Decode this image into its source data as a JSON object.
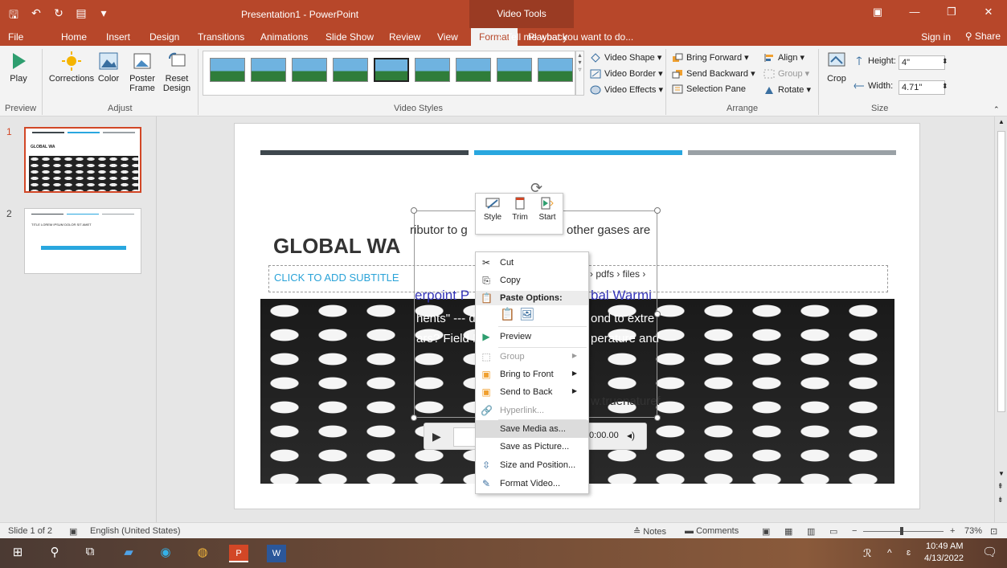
{
  "titlebar": {
    "doc_title": "Presentation1 - PowerPoint",
    "context_tab": "Video Tools"
  },
  "tabs": {
    "items": [
      "File",
      "Home",
      "Insert",
      "Design",
      "Transitions",
      "Animations",
      "Slide Show",
      "Review",
      "View",
      "Format",
      "Playback"
    ],
    "active": "Format",
    "tell_me": "Tell me what you want to do...",
    "sign_in": "Sign in",
    "share": "Share"
  },
  "ribbon": {
    "preview": {
      "play": "Play",
      "label": "Preview"
    },
    "adjust": {
      "corrections": "Corrections",
      "color": "Color",
      "poster_frame": "Poster Frame",
      "reset_design": "Reset Design",
      "label": "Adjust"
    },
    "video_styles": {
      "label": "Video Styles",
      "video_shape": "Video Shape",
      "video_border": "Video Border",
      "video_effects": "Video Effects"
    },
    "arrange": {
      "bring_forward": "Bring Forward",
      "send_backward": "Send Backward",
      "selection_pane": "Selection Pane",
      "align": "Align",
      "group": "Group",
      "rotate": "Rotate",
      "label": "Arrange"
    },
    "size": {
      "crop": "Crop",
      "height_label": "Height:",
      "height_value": "4\"",
      "width_label": "Width:",
      "width_value": "4.71\"",
      "label": "Size"
    }
  },
  "thumbs": {
    "slide1_num": "1",
    "slide1_title": "GLOBAL WA",
    "slide2_num": "2",
    "slide2_title": "TITLE LOREM IPSUM DOLOR SIT AMET"
  },
  "slide": {
    "title": "GLOBAL WA",
    "subtitle_placeholder": "CLICK TO ADD SUBTITLE",
    "video_lines": {
      "line1": "ributor to g",
      "line1b": "other gases are",
      "line2b": "› pdfs › files ›",
      "line3": "erpoint P",
      "line3b": "bal Warmi",
      "line4": "hents\" --- d",
      "line4b": "ond to extre",
      "line5": "ars? Field M",
      "line5b": "perature and",
      "line6b": "w.truenaturef"
    },
    "player_time": "0:00.00"
  },
  "minibar": {
    "style": "Style",
    "trim": "Trim",
    "start": "Start"
  },
  "context_menu": {
    "cut": "Cut",
    "copy": "Copy",
    "paste_options": "Paste Options:",
    "preview": "Preview",
    "group": "Group",
    "bring_to_front": "Bring to Front",
    "send_to_back": "Send to Back",
    "hyperlink": "Hyperlink...",
    "save_media_as": "Save Media as...",
    "save_as_picture": "Save as Picture...",
    "size_and_position": "Size and Position...",
    "format_video": "Format Video..."
  },
  "statusbar": {
    "slide_count": "Slide 1 of 2",
    "language": "English (United States)",
    "notes": "Notes",
    "comments": "Comments",
    "zoom": "73%"
  },
  "taskbar": {
    "time": "10:49 AM",
    "date": "4/13/2022"
  },
  "colors": {
    "accent": "#b7472a",
    "bar_dark": "#3e474d",
    "bar_blue": "#29a7df",
    "bar_gray": "#9aa1a6"
  }
}
